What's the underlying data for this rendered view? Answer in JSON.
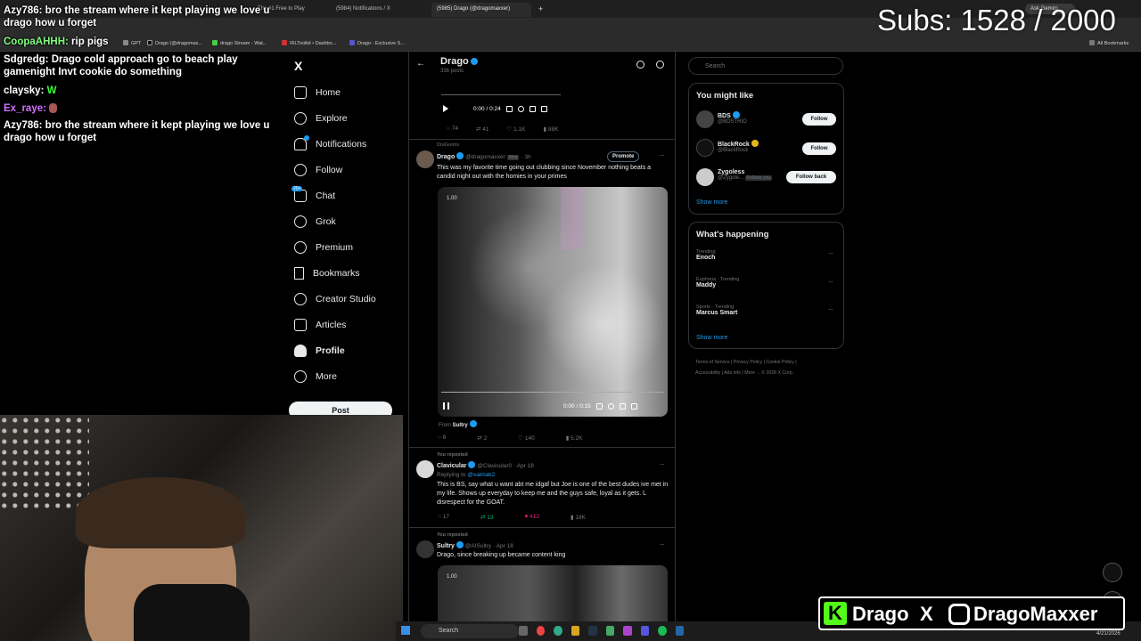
{
  "browser": {
    "tabs": [
      {
        "label": "The #1 Free to Play",
        "active": false
      },
      {
        "label": "(5984) Notifications / X",
        "active": false
      },
      {
        "label": "(5985) Drago (@dragomaxxer)",
        "active": true
      }
    ],
    "ask_gemini": "Ask Gemini",
    "bookmarks": [
      {
        "label": "GPT",
        "color": "#888"
      },
      {
        "label": "Drago (@dragomax...",
        "color": "#111"
      },
      {
        "label": "drago Stream - Wat...",
        "color": "#4c4"
      },
      {
        "label": "IRLToolkit • Dashbo...",
        "color": "#c33"
      },
      {
        "label": "Drago - Exclusive S...",
        "color": "#55c"
      }
    ],
    "all_bookmarks": "All Bookmarks"
  },
  "chat": [
    {
      "user": "Azy786:",
      "msg": "bro the stream where it kept playing we love u drago how u forget",
      "color": "#ffffff"
    },
    {
      "user": "CoopaAHHH:",
      "msg": "rip pigs",
      "color": "#7fff7f"
    },
    {
      "user": "Sdgredg:",
      "msg": "Drago cold approach go to beach play gamenight Invt cookie do something",
      "color": "#ffffff"
    },
    {
      "user": "claysky:",
      "msg": "W",
      "color": "#ffffff"
    },
    {
      "user": "Ex_raye:",
      "msg": "",
      "color": "#d070ff"
    },
    {
      "user": "Azy786:",
      "msg": "bro the stream where it kept playing we love u drago how u forget",
      "color": "#ffffff"
    }
  ],
  "subs": "Subs: 1528 / 2000",
  "sidebar": {
    "logo": "X",
    "items": [
      {
        "label": "Home",
        "bold": false
      },
      {
        "label": "Explore",
        "bold": false
      },
      {
        "label": "Notifications",
        "bold": false
      },
      {
        "label": "Follow",
        "bold": false
      },
      {
        "label": "Chat",
        "bold": false
      },
      {
        "label": "Grok",
        "bold": false
      },
      {
        "label": "Premium",
        "bold": false
      },
      {
        "label": "Bookmarks",
        "bold": false
      },
      {
        "label": "Creator Studio",
        "bold": false
      },
      {
        "label": "Articles",
        "bold": false
      },
      {
        "label": "Profile",
        "bold": true
      },
      {
        "label": "More",
        "bold": false
      }
    ],
    "post_button": "Post",
    "chat_badge": "20+"
  },
  "profile_header": {
    "name": "Drago",
    "posts": "336 posts"
  },
  "timeline": {
    "video1": {
      "time": "0:00 / 0:24",
      "replies": "74",
      "reposts": "41",
      "likes": "1.1K",
      "views": "88K"
    },
    "post1": {
      "community": "DraGoons",
      "name": "Drago",
      "handle": "@dragomaxxer",
      "badge": "Mod",
      "time": "· 3h",
      "promote": "Promote",
      "text": "This was my favorite time going out clubbing since November nothing beats a candid night out with the homies in your primes",
      "video_label": "1.00",
      "video_time": "0:00 / 0:15",
      "from": "From",
      "from_name": "Sultry",
      "replies": "8",
      "reposts": "2",
      "likes": "140",
      "views": "5.2K"
    },
    "post2": {
      "reposted": "You reposted",
      "name": "Clavicular",
      "handle": "@Clavicular0",
      "time": "· Apr 18",
      "replying": "Replying to",
      "replying_to": "@xaimak2",
      "text": "This is BS, say what u want abt me idgaf but Joe is one of the best dudes ive met in my life. Shows up everyday to keep me and the guys safe, loyal as it gets. L disrespect for the GOAT.",
      "replies": "17",
      "reposts": "13",
      "likes": "412",
      "views": "18K"
    },
    "post3": {
      "reposted": "You reposted",
      "name": "Sultry",
      "handle": "@AISultry",
      "time": "· Apr 18",
      "text": "Drago, since breaking up became content king",
      "video_label": "1.00"
    }
  },
  "right": {
    "search_placeholder": "Search",
    "you_might_like": "You might like",
    "suggestions": [
      {
        "name": "BDS",
        "handle": "@BDSTRIO",
        "button": "Follow",
        "follows_you": ""
      },
      {
        "name": "BlackRock",
        "handle": "@BlackRock",
        "button": "Follow",
        "follows_you": ""
      },
      {
        "name": "Zygoless",
        "handle": "@Zygole...",
        "button": "Follow back",
        "follows_you": "Follows you"
      }
    ],
    "show_more": "Show more",
    "whats_happening": "What's happening",
    "trends": [
      {
        "category": "Trending",
        "name": "Enoch"
      },
      {
        "category": "Euphoria · Trending",
        "name": "Maddy"
      },
      {
        "category": "Sports · Trending",
        "name": "Marcus Smart"
      }
    ],
    "footer": [
      "Terms of Service",
      "Privacy Policy",
      "Cookie Policy",
      "Accessibility",
      "Ads info",
      "More ...",
      "© 2026 X Corp."
    ]
  },
  "taskbar": {
    "search": "Search",
    "time": "PM",
    "date": "4/21/2026"
  },
  "overlay_brand": {
    "name": "Drago",
    "x": "X",
    "ig": "DragoMaxxer"
  }
}
